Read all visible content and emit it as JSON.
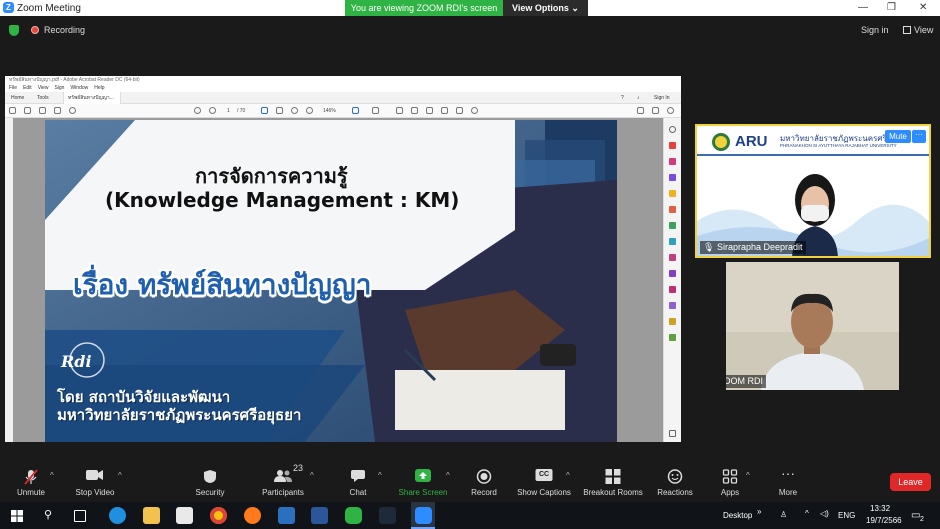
{
  "window": {
    "title": "Zoom Meeting",
    "logo_letter": "Z"
  },
  "share_banner": {
    "message": "You are viewing ZOOM RDI's screen",
    "options_label": "View Options"
  },
  "status": {
    "recording_label": "Recording",
    "sign_in_label": "Sign in",
    "view_label": "View"
  },
  "pdf_app": {
    "title": "ทรัพย์สินทางปัญญา.pdf - Adobe Acrobat Reader DC (64-bit)",
    "menu": [
      "File",
      "Edit",
      "View",
      "Sign",
      "Window",
      "Help"
    ],
    "tabs": [
      "Home",
      "Tools",
      "ทรัพย์สินทางปัญญา..."
    ],
    "sign_in": "Sign In",
    "page_current": "1",
    "page_total": "/ 70",
    "zoom": "146%"
  },
  "slide": {
    "title_line1": "การจัดการความรู้",
    "title_line2": "(Knowledge Management : KM)",
    "topic": "เรื่อง ทรัพย์สินทางปัญญา",
    "logo_text": "Rdi",
    "by_line": "โดย สถาบันวิจัยและพัฒนา",
    "university_line": "มหาวิทยาลัยราชภัฏพระนครศรีอยุธยา"
  },
  "participants_tiles": [
    {
      "name": "Siraprapha Deepradit",
      "banner_logo": "ARU",
      "banner_thai": "มหาวิทยาลัยราชภัฏพระนครศรีอยุธยา",
      "banner_en": "PHRANAKHON SI AYUTTHAYA RAJABHAT UNIVERSITY",
      "mute_label": "Mute",
      "more_label": "···"
    },
    {
      "name": "ZOOM RDI"
    }
  ],
  "toolbar": {
    "unmute": "Unmute",
    "stop_video": "Stop Video",
    "security": "Security",
    "participants": "Participants",
    "participants_count": "23",
    "chat": "Chat",
    "share_screen": "Share Screen",
    "record": "Record",
    "show_captions": "Show Captions",
    "captions_badge": "CC",
    "breakout_rooms": "Breakout Rooms",
    "reactions": "Reactions",
    "apps": "Apps",
    "more": "More",
    "leave": "Leave"
  },
  "taskbar": {
    "desktop_label": "Desktop",
    "lang": "ENG",
    "time": "13:32",
    "date": "19/7/2566",
    "notifications": "2"
  },
  "colors": {
    "zoom_blue": "#2d8cff",
    "share_green": "#2fb344",
    "leave_red": "#e02828",
    "active_speaker": "#f2d23c",
    "slide_blue": "#2f4f7a"
  }
}
